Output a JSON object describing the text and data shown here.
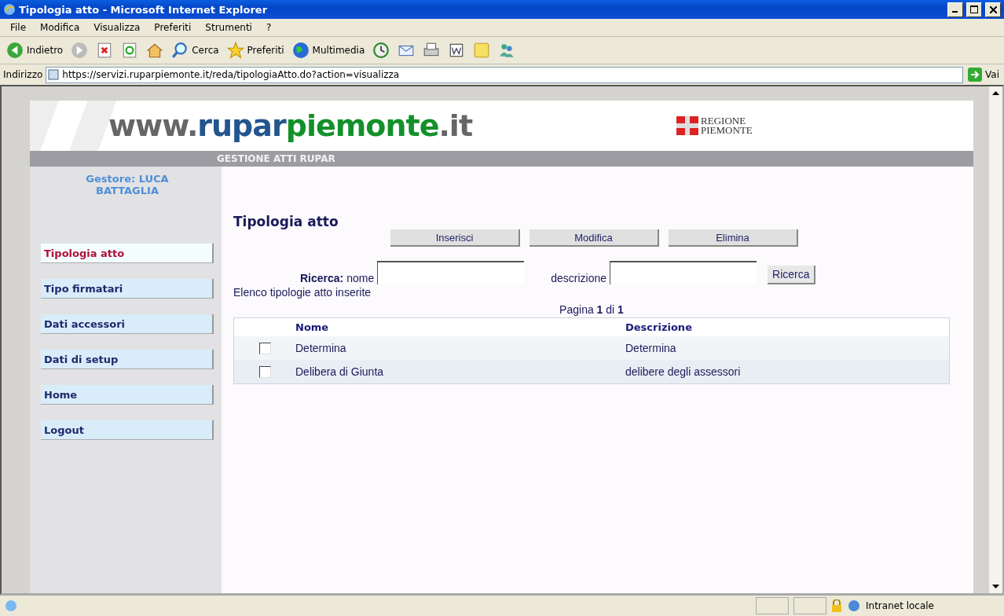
{
  "window": {
    "title": "Tipologia atto - Microsoft Internet Explorer"
  },
  "menu": [
    "File",
    "Modifica",
    "Visualizza",
    "Preferiti",
    "Strumenti",
    "?"
  ],
  "toolbar": [
    {
      "kind": "back",
      "label": "Indietro"
    },
    {
      "kind": "forward"
    },
    {
      "kind": "stop"
    },
    {
      "kind": "refresh"
    },
    {
      "kind": "home"
    },
    {
      "kind": "search",
      "label": "Cerca"
    },
    {
      "kind": "favorites",
      "label": "Preferiti"
    },
    {
      "kind": "media",
      "label": "Multimedia"
    },
    {
      "kind": "history"
    },
    {
      "kind": "mail"
    },
    {
      "kind": "print"
    },
    {
      "kind": "edit"
    },
    {
      "kind": "note"
    },
    {
      "kind": "messenger"
    }
  ],
  "address": {
    "label": "Indirizzo",
    "url": "https://servizi.ruparpiemonte.it/reda/tipologiaAtto.do?action=visualizza",
    "go": "Vai"
  },
  "header": {
    "logo": [
      {
        "kind": "grey",
        "text": "www."
      },
      {
        "kind": "blue",
        "text": "rupar"
      },
      {
        "kind": "green",
        "text": "piemonte"
      },
      {
        "kind": "grey",
        "text": ".it"
      }
    ],
    "region": [
      "REGIONE",
      "PIEMONTE"
    ],
    "band": "GESTIONE ATTI RUPAR"
  },
  "sidebar": {
    "user": "Gestore: LUCA BATTAGLIA",
    "items": [
      {
        "label": "Tipologia atto",
        "selected": true
      },
      {
        "label": "Tipo firmatari",
        "selected": false
      },
      {
        "label": "Dati accessori",
        "selected": false
      },
      {
        "label": "Dati di setup",
        "selected": false
      },
      {
        "label": "Home",
        "selected": false
      },
      {
        "label": "Logout",
        "selected": false
      }
    ]
  },
  "main": {
    "title": "Tipologia atto",
    "buttons": [
      "Inserisci",
      "Modifica",
      "Elimina"
    ],
    "search": {
      "label": "Ricerca:",
      "fields": [
        "nome",
        "descrizione"
      ],
      "button": "Ricerca"
    },
    "caption": "Elenco tipologie atto inserite",
    "pagination": "Pagina **1** di **1**",
    "table": {
      "columns": [
        "Nome",
        "Descrizione"
      ],
      "rows": [
        {
          "checked": false,
          "cells": [
            "Determina",
            "Determina"
          ]
        },
        {
          "checked": false,
          "cells": [
            "Delibera di Giunta",
            "delibere degli assessori"
          ]
        }
      ]
    }
  },
  "status_bar": {
    "zone": "Intranet locale"
  }
}
